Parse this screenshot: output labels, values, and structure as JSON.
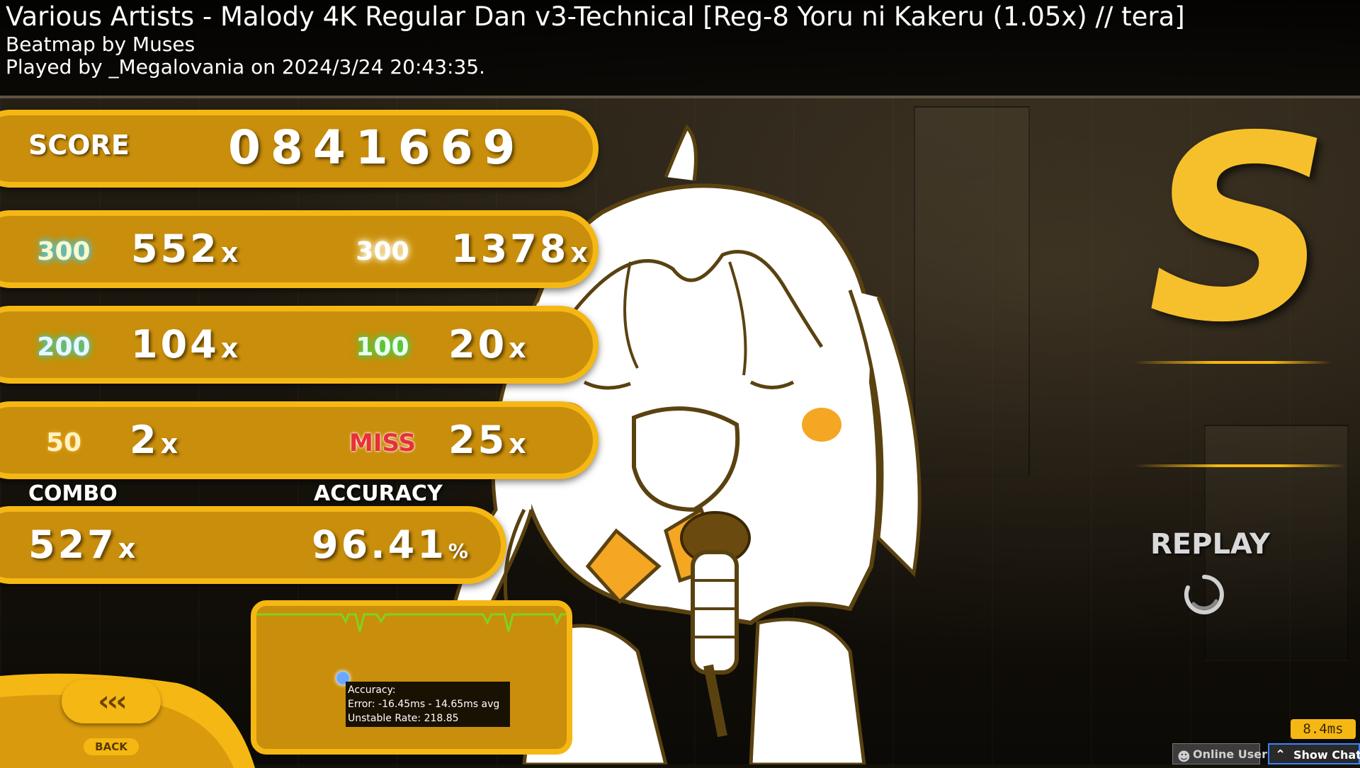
{
  "header": {
    "title": "Various Artists - Malody 4K Regular Dan v3-Technical [Reg-8 Yoru ni Kakeru (1.05x) // tera]",
    "beatmap_by": "Beatmap by Muses",
    "played_by": "Played by _Megalovania on 2024/3/24 20:43:35."
  },
  "score": {
    "label": "SCORE",
    "value": "0841669"
  },
  "judgements": {
    "perfect_300": {
      "label": "300",
      "count": "552",
      "suffix": "x"
    },
    "geki_300": {
      "label": "300",
      "count": "1378",
      "suffix": "x"
    },
    "good_200": {
      "label": "200",
      "count": "104",
      "suffix": "x"
    },
    "ok_100": {
      "label": "100",
      "count": "20",
      "suffix": "x"
    },
    "meh_50": {
      "label": "50",
      "count": "2",
      "suffix": "x"
    },
    "miss": {
      "label": "MISS",
      "count": "25",
      "suffix": "x"
    }
  },
  "combo": {
    "label": "COMBO",
    "value": "527",
    "suffix": "x"
  },
  "accuracy": {
    "label": "ACCURACY",
    "value": "96.41",
    "suffix": "%"
  },
  "graph_tooltip": {
    "line1": "Accuracy:",
    "line2": "Error: -16.45ms - 14.65ms avg",
    "line3": "Unstable Rate: 218.85"
  },
  "grade": "S",
  "replay": {
    "label": "REPLAY"
  },
  "back": {
    "icon_text": "‹‹‹",
    "label": "BACK"
  },
  "fps_counter": "8.4ms",
  "bottom_bar": {
    "online_users": "Online Users",
    "show_chat": "Show Chat"
  },
  "colors": {
    "panel_fill": "#c98e0b",
    "panel_border": "#f5b713",
    "grade": "#f6c02c",
    "graph_line": "#7ed321",
    "miss": "#e8303a"
  },
  "icons": [
    "back-chevrons-icon",
    "replay-spinner-icon",
    "online-users-icon",
    "chevron-up-icon"
  ]
}
